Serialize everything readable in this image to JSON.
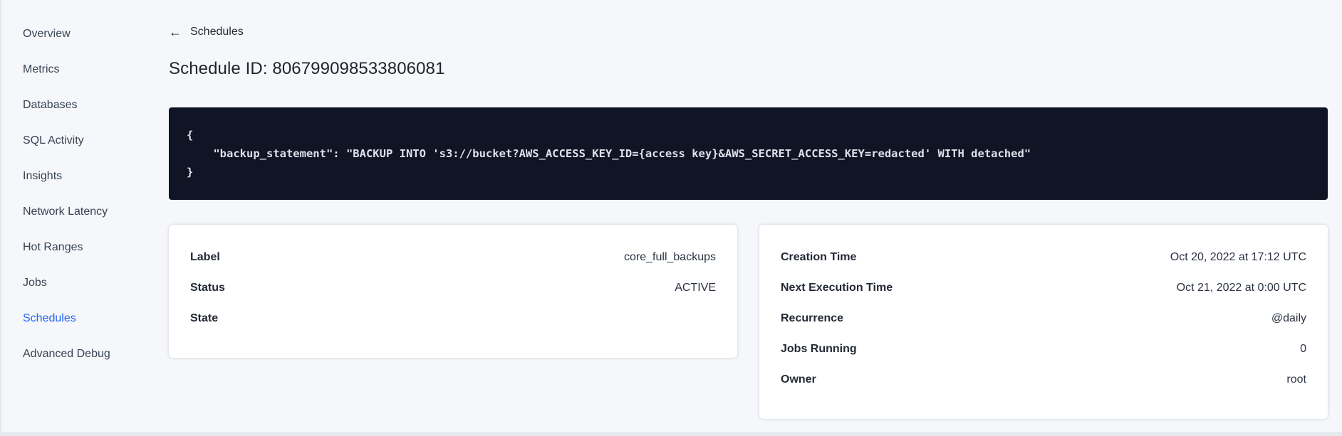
{
  "colors": {
    "page_background": "#f5f7fa",
    "accent_blue": "#2166f2",
    "code_background": "#0f1524",
    "code_text": "#dce1ea",
    "text_dark": "#242a35"
  },
  "sidebar": {
    "items": [
      {
        "label": "Overview",
        "active": false
      },
      {
        "label": "Metrics",
        "active": false
      },
      {
        "label": "Databases",
        "active": false
      },
      {
        "label": "SQL Activity",
        "active": false
      },
      {
        "label": "Insights",
        "active": false
      },
      {
        "label": "Network Latency",
        "active": false
      },
      {
        "label": "Hot Ranges",
        "active": false
      },
      {
        "label": "Jobs",
        "active": false
      },
      {
        "label": "Schedules",
        "active": true
      },
      {
        "label": "Advanced Debug",
        "active": false
      }
    ]
  },
  "header": {
    "back_arrow": "←",
    "back_label": "Schedules",
    "title": "Schedule ID: 806799098533806081"
  },
  "code_block": {
    "text": "{\n    \"backup_statement\": \"BACKUP INTO 's3://bucket?AWS_ACCESS_KEY_ID={access key}&AWS_SECRET_ACCESS_KEY=redacted' WITH detached\"\n}"
  },
  "summary_card": {
    "rows": [
      {
        "label": "Label",
        "value": "core_full_backups"
      },
      {
        "label": "Status",
        "value": "ACTIVE"
      },
      {
        "label": "State",
        "value": ""
      }
    ]
  },
  "schedule_card": {
    "rows": [
      {
        "label": "Creation Time",
        "value": "Oct 20, 2022 at 17:12 UTC"
      },
      {
        "label": "Next Execution Time",
        "value": "Oct 21, 2022 at 0:00 UTC"
      },
      {
        "label": "Recurrence",
        "value": "@daily"
      },
      {
        "label": "Jobs Running",
        "value": "0"
      },
      {
        "label": "Owner",
        "value": "root"
      }
    ]
  }
}
